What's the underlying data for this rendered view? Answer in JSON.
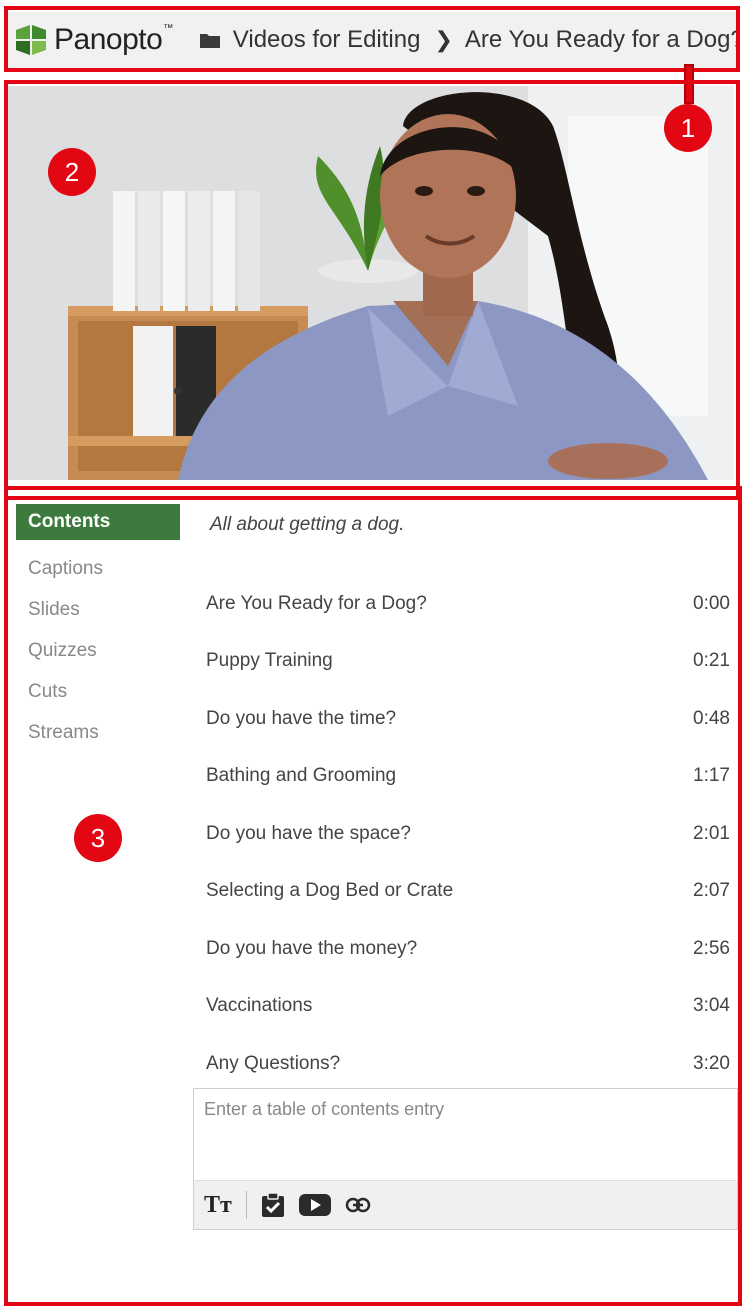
{
  "header": {
    "brand": "Panopto",
    "brand_mark": "™",
    "breadcrumb_folder": "Videos for Editing",
    "breadcrumb_session": "Are You Ready for a Dog?"
  },
  "callouts": [
    "1",
    "2",
    "3"
  ],
  "tabs": [
    "Contents",
    "Captions",
    "Slides",
    "Quizzes",
    "Cuts",
    "Streams"
  ],
  "contents": {
    "description": "All about getting a dog.",
    "entries": [
      {
        "title": "Are You Ready for a Dog?",
        "time": "0:00"
      },
      {
        "title": "Puppy Training",
        "time": "0:21"
      },
      {
        "title": "Do you have the time?",
        "time": "0:48"
      },
      {
        "title": "Bathing and Grooming",
        "time": "1:17"
      },
      {
        "title": "Do you have the space?",
        "time": "2:01"
      },
      {
        "title": "Selecting a Dog Bed or Crate",
        "time": "2:07"
      },
      {
        "title": "Do you have the money?",
        "time": "2:56"
      },
      {
        "title": "Vaccinations",
        "time": "3:04"
      },
      {
        "title": "Any Questions?",
        "time": "3:20"
      }
    ],
    "entry_placeholder": "Enter a table of contents entry",
    "format_label": "Tт"
  },
  "colors": {
    "accent": "#3d7a3d",
    "annotation": "#e30613"
  }
}
